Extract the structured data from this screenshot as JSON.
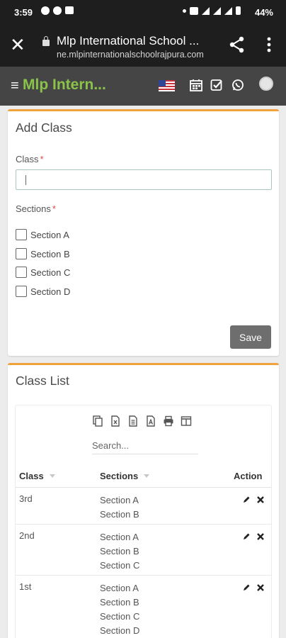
{
  "status_bar": {
    "time": "3:59",
    "battery": "44%",
    "icons": [
      "chat-bubble-icon",
      "messenger-icon",
      "gallery-icon",
      "dot-icon",
      "data-icon",
      "wifi-icon",
      "signal-icon",
      "signal-icon",
      "battery-icon"
    ]
  },
  "browser": {
    "title": "Mlp International School ...",
    "url": "ne.mlpinternationalschoolrajpura.com"
  },
  "app_header": {
    "brand": "Mlp Intern...",
    "brand_color": "#8bc34a",
    "icons": [
      "us-flag-icon",
      "calendar-icon",
      "check-square-icon",
      "whatsapp-icon",
      "user-avatar-icon"
    ]
  },
  "add_class": {
    "title": "Add Class",
    "class_label": "Class",
    "class_value": "",
    "sections_label": "Sections",
    "sections": [
      "Section A",
      "Section B",
      "Section C",
      "Section D"
    ],
    "save_label": "Save"
  },
  "class_list": {
    "title": "Class List",
    "export_icons": [
      "copy-icon",
      "excel-icon",
      "csv-icon",
      "pdf-icon",
      "print-icon",
      "columns-icon"
    ],
    "search_placeholder": "Search...",
    "columns": {
      "class": "Class",
      "sections": "Sections",
      "action": "Action"
    },
    "rows": [
      {
        "class": "3rd",
        "sections": [
          "Section A",
          "Section B"
        ]
      },
      {
        "class": "2nd",
        "sections": [
          "Section A",
          "Section B",
          "Section C"
        ]
      },
      {
        "class": "1st",
        "sections": [
          "Section A",
          "Section B",
          "Section C",
          "Section D"
        ]
      }
    ]
  },
  "accent_color": "#f0a23d"
}
